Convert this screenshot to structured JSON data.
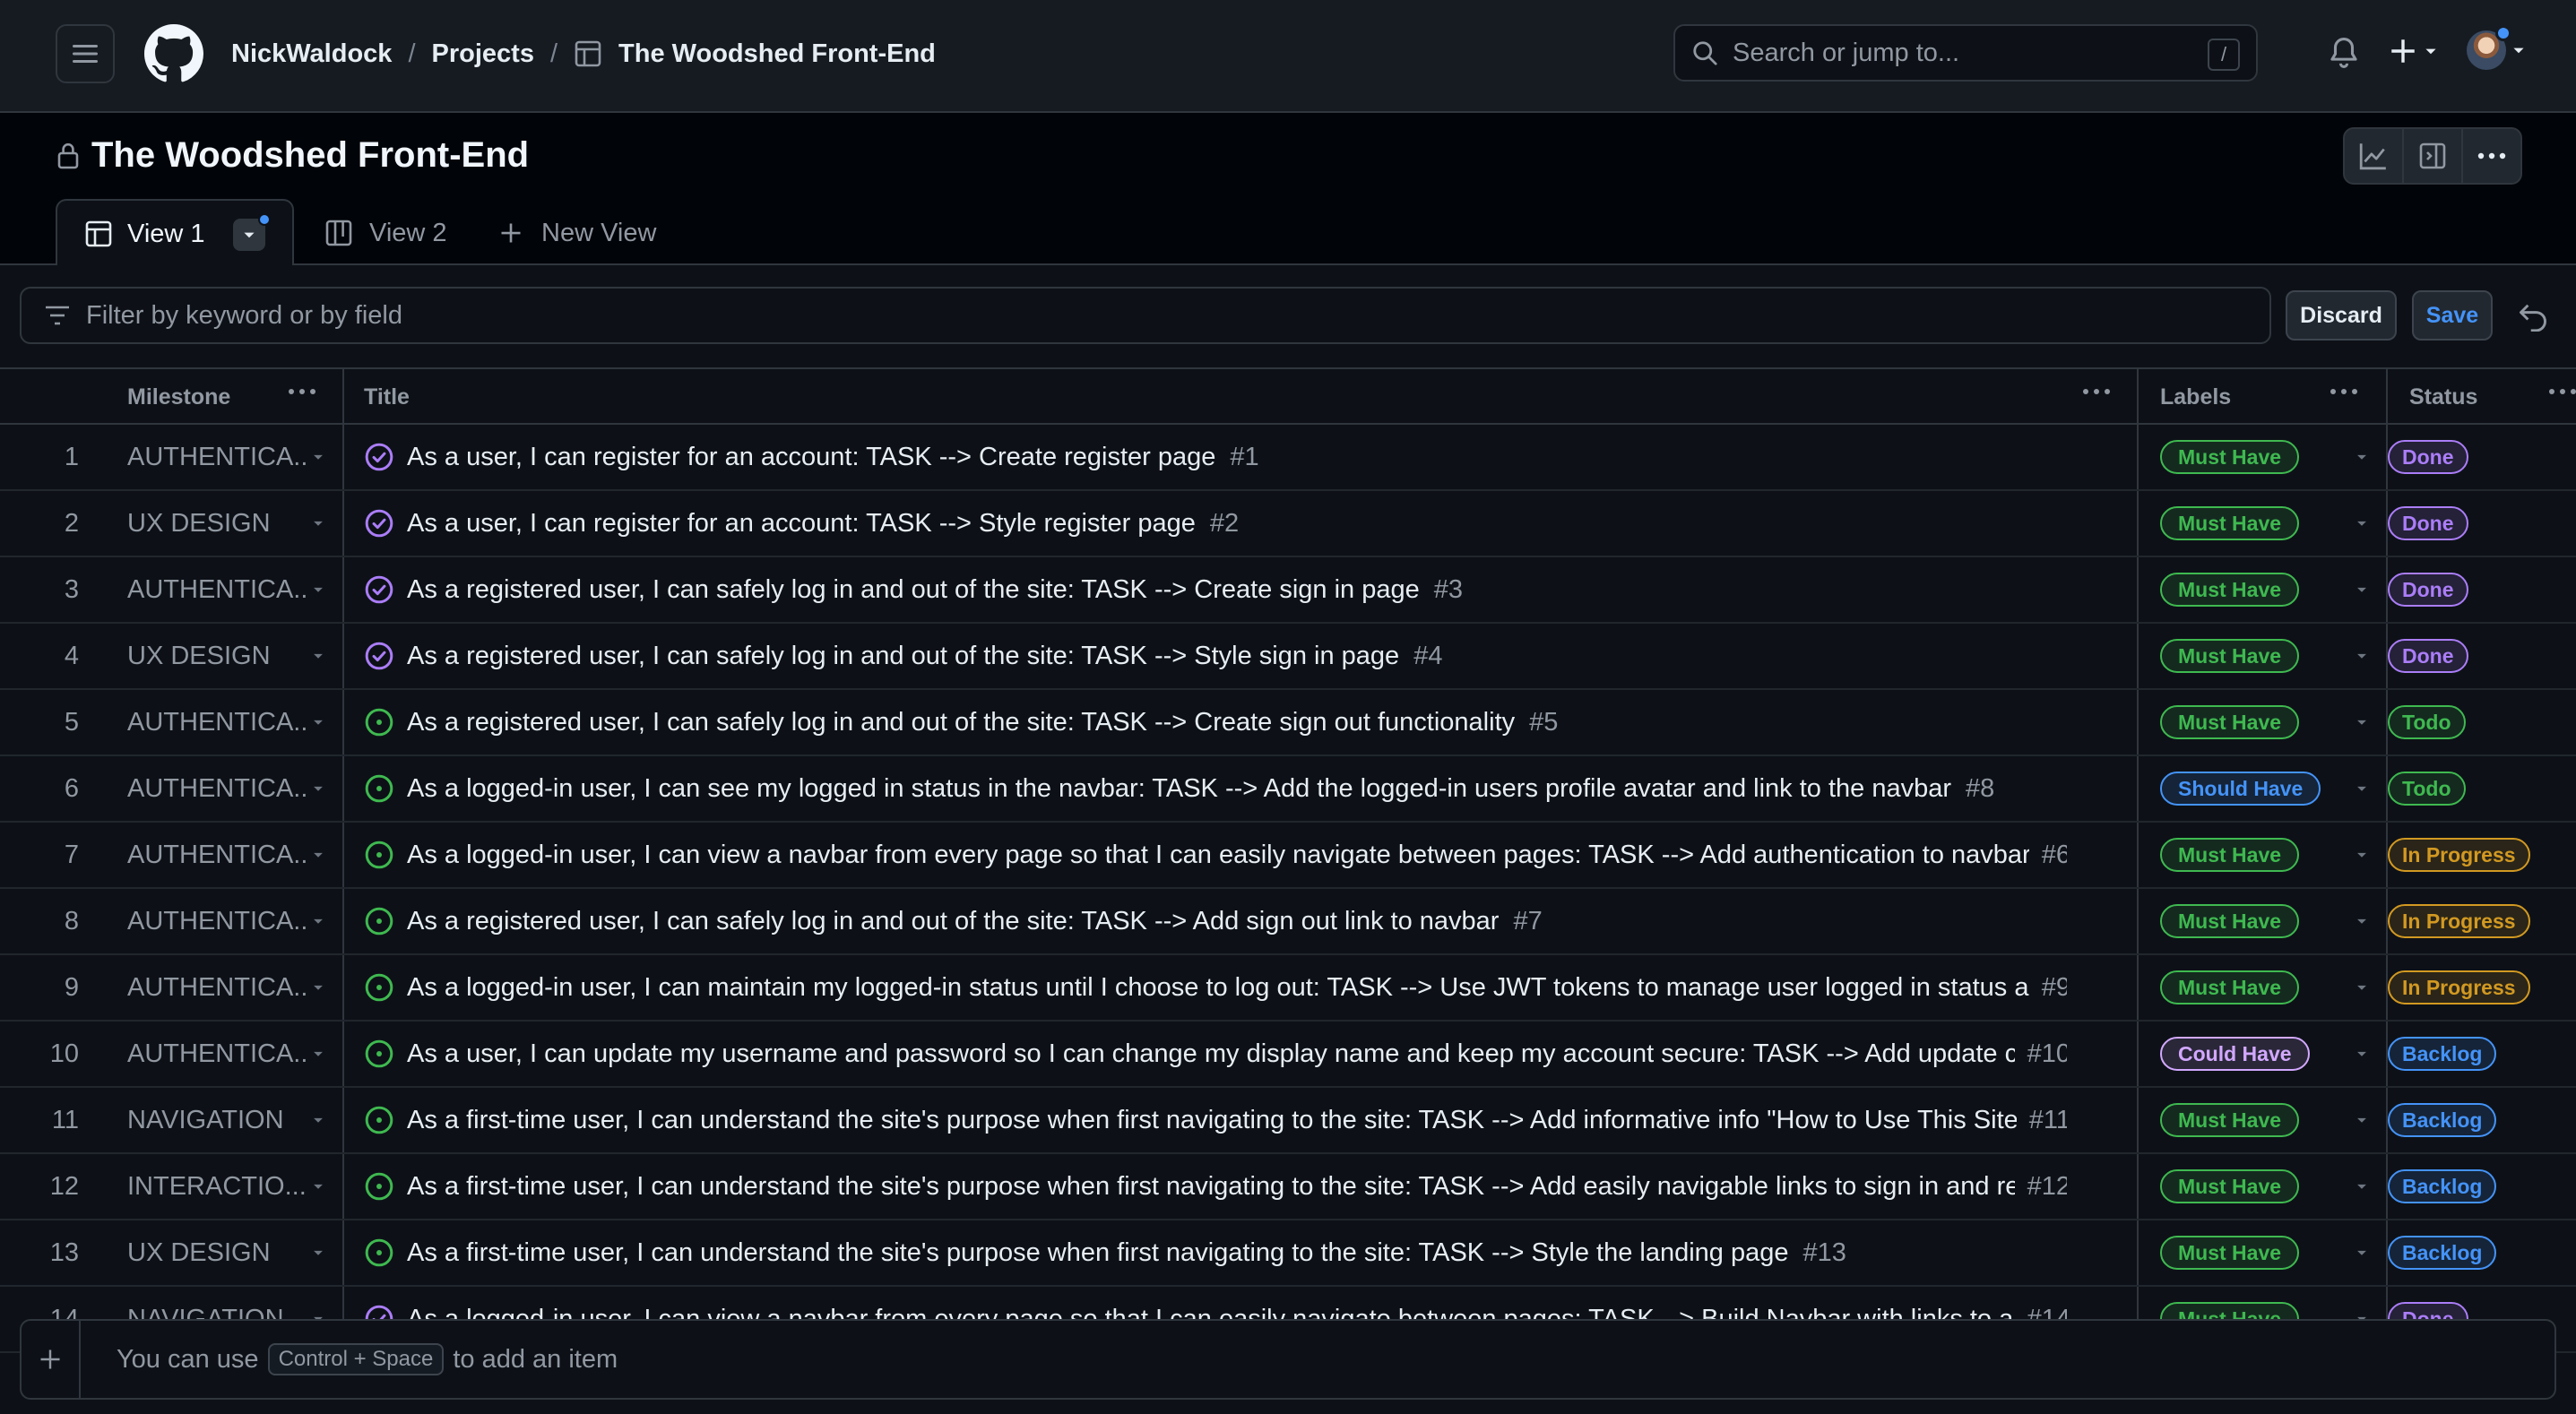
{
  "header": {
    "breadcrumbs": [
      "NickWaldock",
      "Projects",
      "The Woodshed Front-End"
    ],
    "search_placeholder": "Search or jump to...",
    "search_shortcut": "/"
  },
  "project": {
    "title": "The Woodshed Front-End"
  },
  "views": {
    "tabs": [
      {
        "label": "View 1",
        "active": true
      },
      {
        "label": "View 2",
        "active": false
      }
    ],
    "new_view_label": "New View"
  },
  "filter": {
    "placeholder": "Filter by keyword or by field",
    "discard_label": "Discard",
    "save_label": "Save"
  },
  "table": {
    "columns": [
      "Milestone",
      "Title",
      "Labels",
      "Status"
    ],
    "rows": [
      {
        "num": "1",
        "milestone": "AUTHENTICA...",
        "title": "As a user, I can register for an account: TASK --> Create register page",
        "issue": "#1",
        "state": "closed",
        "label": "Must Have",
        "status": "Done"
      },
      {
        "num": "2",
        "milestone": "UX DESIGN",
        "title": "As a user, I can register for an account: TASK --> Style register page",
        "issue": "#2",
        "state": "closed",
        "label": "Must Have",
        "status": "Done"
      },
      {
        "num": "3",
        "milestone": "AUTHENTICA...",
        "title": "As a registered user, I can safely log in and out of the site: TASK --> Create sign in page",
        "issue": "#3",
        "state": "closed",
        "label": "Must Have",
        "status": "Done"
      },
      {
        "num": "4",
        "milestone": "UX DESIGN",
        "title": "As a registered user, I can safely log in and out of the site: TASK --> Style sign in page",
        "issue": "#4",
        "state": "closed",
        "label": "Must Have",
        "status": "Done"
      },
      {
        "num": "5",
        "milestone": "AUTHENTICA...",
        "title": "As a registered user, I can safely log in and out of the site: TASK --> Create sign out functionality",
        "issue": "#5",
        "state": "open",
        "label": "Must Have",
        "status": "Todo"
      },
      {
        "num": "6",
        "milestone": "AUTHENTICA...",
        "title": "As a logged-in user, I can see my logged in status in the navbar: TASK --> Add the logged-in users profile avatar and link to the navbar",
        "issue": "#8",
        "state": "open",
        "label": "Should Have",
        "status": "Todo"
      },
      {
        "num": "7",
        "milestone": "AUTHENTICA...",
        "title": "As a logged-in user, I can view a navbar from every page so that I can easily navigate between pages: TASK --> Add authentication to navbar ...",
        "issue": "#6",
        "state": "open",
        "label": "Must Have",
        "status": "In Progress",
        "truncated": true
      },
      {
        "num": "8",
        "milestone": "AUTHENTICA...",
        "title": "As a registered user, I can safely log in and out of the site: TASK --> Add sign out link to navbar",
        "issue": "#7",
        "state": "open",
        "label": "Must Have",
        "status": "In Progress"
      },
      {
        "num": "9",
        "milestone": "AUTHENTICA...",
        "title": "As a logged-in user, I can maintain my logged-in status until I choose to log out: TASK --> Use JWT tokens to manage user logged in status a...",
        "issue": "#9",
        "state": "open",
        "label": "Must Have",
        "status": "In Progress",
        "truncated": true
      },
      {
        "num": "10",
        "milestone": "AUTHENTICA...",
        "title": "As a user, I can update my username and password so I can change my display name and keep my account secure: TASK --> Add update cre...",
        "issue": "#10",
        "state": "open",
        "label": "Could Have",
        "status": "Backlog",
        "truncated": true
      },
      {
        "num": "11",
        "milestone": "NAVIGATION",
        "title": "As a first-time user, I can understand the site's purpose when first navigating to the site: TASK --> Add informative info \"How to Use This Site...",
        "issue": "#11",
        "state": "open",
        "label": "Must Have",
        "status": "Backlog",
        "truncated": true
      },
      {
        "num": "12",
        "milestone": "INTERACTIO...",
        "title": "As a first-time user, I can understand the site's purpose when first navigating to the site: TASK --> Add easily navigable links to sign in and re...",
        "issue": "#12",
        "state": "open",
        "label": "Must Have",
        "status": "Backlog",
        "truncated": true
      },
      {
        "num": "13",
        "milestone": "UX DESIGN",
        "title": "As a first-time user, I can understand the site's purpose when first navigating to the site: TASK --> Style the landing page",
        "issue": "#13",
        "state": "open",
        "label": "Must Have",
        "status": "Backlog"
      },
      {
        "num": "14",
        "milestone": "NAVIGATION",
        "title": "As a logged-in user, I can view a navbar from every page so that I can easily navigate between pages: TASK --> Build Navbar with links to all...",
        "issue": "#14",
        "state": "closed",
        "label": "Must Have",
        "status": "Done",
        "truncated": true
      }
    ]
  },
  "add_item": {
    "prefix": "You can use",
    "shortcut": "Control + Space",
    "suffix": "to add an item"
  },
  "colors": {
    "label_must": "#3fb950",
    "label_should": "#4493f8",
    "label_could": "#d2a8ff",
    "status_done": "#ab7df8",
    "status_todo": "#3fb950",
    "status_inprogress": "#d29922",
    "status_backlog": "#4493f8",
    "icon_closed": "#ab7df8",
    "icon_open": "#3fb950"
  }
}
